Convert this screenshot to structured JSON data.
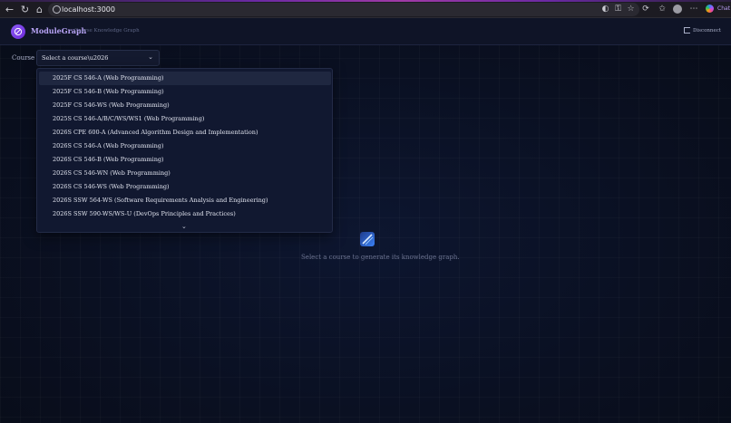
{
  "browser": {
    "url": "localhost:3000",
    "chat_label": "Chat"
  },
  "app": {
    "brand": "ModuleGraph",
    "tagline": "Course Knowledge Graph",
    "disconnect_label": "Disconnect",
    "course_label": "Course",
    "select_value": "Select a course\\u2026",
    "options": [
      "2025F CS 546-A (Web Programming)",
      "2025F CS 546-B (Web Programming)",
      "2025F CS 546-WS (Web Programming)",
      "2025S CS 546-A/B/C/WS/WS1 (Web Programming)",
      "2026S CPE 600-A (Advanced Algorithm Design and Implementation)",
      "2026S CS 546-A (Web Programming)",
      "2026S CS 546-B (Web Programming)",
      "2026S CS 546-WN (Web Programming)",
      "2026S CS 546-WS (Web Programming)",
      "2026S SSW 564-WS (Software Requirements Analysis and Engineering)",
      "2026S SSW 590-WS/WS-U (DevOps Principles and Practices)"
    ],
    "empty_message": "Select a course to generate its knowledge graph."
  },
  "colors": {
    "accent": "#8b5cf6",
    "background": "#0b1020"
  }
}
